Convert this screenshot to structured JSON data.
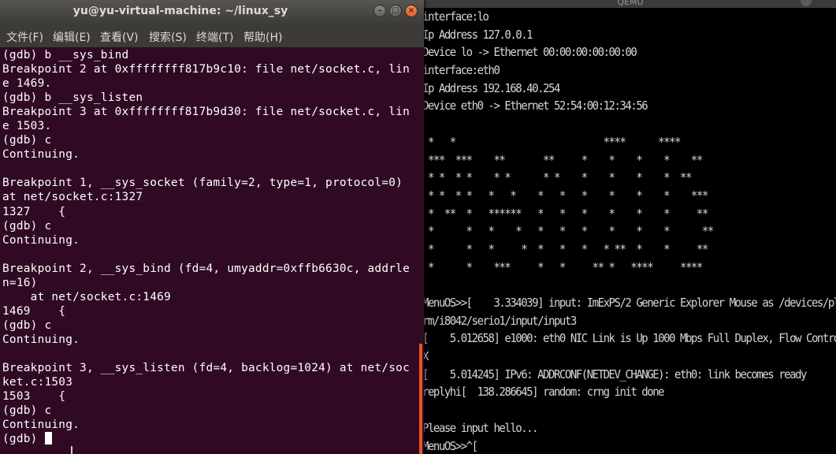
{
  "qemu_window": {
    "title": "QEMU",
    "lines": [
      "interface:lo",
      "Ip Address 127.0.0.1",
      "Device lo -> Ethernet 00:00:00:00:00:00",
      "interface:eth0",
      "Ip Address 192.168.40.254",
      "Device eth0 -> Ethernet 52:54:00:12:34:56",
      "",
      " *   *                           ****      ****",
      " ***  ***    **       **     *    *    *    *    **",
      " * *  * *    * *      * *    *    *    *    *  **",
      " * *  * *   *   *    *   *   *    *    *    *    ***",
      " *  **  *   ******   *   *   *    *    *    *     **",
      " *      *   *    *   *   *   *    *    *    *      **",
      " *      *   *     *  *   *   *   * **  *    *     **",
      " *      *    ***     *   *     ** *   ****     ****",
      "",
      "MenuOS>>[    3.334039] input: ImExPS/2 Generic Explorer Mouse as /devices/platfo",
      "rm/i8042/serio1/input/input3",
      "[    5.012658] e1000: eth0 NIC Link is Up 1000 Mbps Full Duplex, Flow Control: R",
      "X",
      "[    5.014245] IPv6: ADDRCONF(NETDEV_CHANGE): eth0: link becomes ready",
      "replyhi[  138.286645] random: crng init done",
      "",
      "Please input hello...",
      "MenuOS>>^["
    ]
  },
  "terminal": {
    "title": "yu@yu-virtual-machine: ~/linux_sy",
    "window_buttons": {
      "minimize": "–",
      "maximize": "□",
      "close": "×"
    },
    "menu": [
      "文件(F)",
      "编辑(E)",
      "查看(V)",
      "搜索(S)",
      "终端(T)",
      "帮助(H)"
    ],
    "lines": [
      "(gdb) b __sys_bind",
      "Breakpoint 2 at 0xffffffff817b9c10: file net/socket.c, lin",
      "e 1469.",
      "(gdb) b __sys_listen",
      "Breakpoint 3 at 0xffffffff817b9d30: file net/socket.c, lin",
      "e 1503.",
      "(gdb) c",
      "Continuing.",
      "",
      "Breakpoint 1, __sys_socket (family=2, type=1, protocol=0)",
      "at net/socket.c:1327",
      "1327    {",
      "(gdb) c",
      "Continuing.",
      "",
      "Breakpoint 2, __sys_bind (fd=4, umyaddr=0xffb6630c, addrle",
      "n=16)",
      "    at net/socket.c:1469",
      "1469    {",
      "(gdb) c",
      "Continuing.",
      "",
      "Breakpoint 3, __sys_listen (fd=4, backlog=1024) at net/soc",
      "ket.c:1503",
      "1503    {",
      "(gdb) c",
      "Continuing."
    ],
    "prompt": "(gdb) "
  },
  "colors": {
    "terminal_background": "#300a24",
    "terminal_text": "#ffffff",
    "qemu_background": "#000000",
    "qemu_text": "#d6d6d6",
    "titlebar": "#3c3b37",
    "close_button": "#e95420",
    "scrollbar_accent": "#e95420"
  }
}
